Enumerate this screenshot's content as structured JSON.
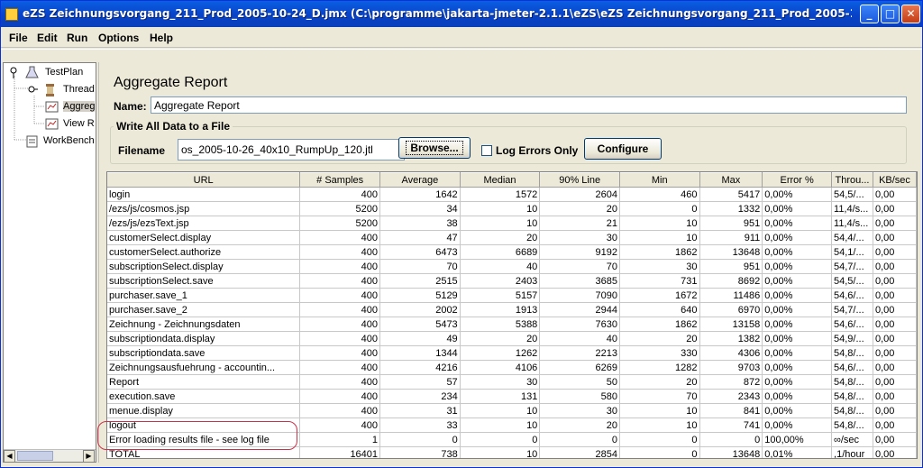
{
  "window": {
    "title": "eZS Zeichnungsvorgang_211_Prod_2005-10-24_D.jmx (C:\\programme\\jakarta-jmeter-2.1.1\\eZS\\eZS Zeichnungsvorgang_211_Prod_2005-10-24_...",
    "minimize": "_",
    "maximize": "□",
    "close": "✕"
  },
  "menu": [
    "File",
    "Edit",
    "Run",
    "Options",
    "Help"
  ],
  "tree": {
    "items": [
      {
        "label": "TestPlan",
        "icon": "flask-icon"
      },
      {
        "label": "Thread",
        "icon": "spool-icon"
      },
      {
        "label": "Aggreg",
        "icon": "report-icon"
      },
      {
        "label": "View R",
        "icon": "report-icon"
      },
      {
        "label": "WorkBench",
        "icon": "clipboard-icon"
      }
    ],
    "scroll_left": "◀",
    "scroll_right": "▶"
  },
  "report": {
    "title": "Aggregate Report",
    "name_label": "Name:",
    "name_value": "Aggregate Report",
    "group_title": "Write All Data to a File",
    "filename_label": "Filename",
    "filename_value": "os_2005-10-26_40x10_RumpUp_120.jtl",
    "browse_label": "Browse...",
    "log_errors_label": "Log Errors Only",
    "configure_label": "Configure"
  },
  "table": {
    "columns": [
      "URL",
      "# Samples",
      "Average",
      "Median",
      "90% Line",
      "Min",
      "Max",
      "Error %",
      "Throu...",
      "KB/sec"
    ],
    "rows": [
      [
        "login",
        "400",
        "1642",
        "1572",
        "2604",
        "460",
        "5417",
        "0,00%",
        "54,5/...",
        "0,00"
      ],
      [
        "/ezs/js/cosmos.jsp",
        "5200",
        "34",
        "10",
        "20",
        "0",
        "1332",
        "0,00%",
        "11,4/s...",
        "0,00"
      ],
      [
        "/ezs/js/ezsText.jsp",
        "5200",
        "38",
        "10",
        "21",
        "10",
        "951",
        "0,00%",
        "11,4/s...",
        "0,00"
      ],
      [
        "customerSelect.display",
        "400",
        "47",
        "20",
        "30",
        "10",
        "911",
        "0,00%",
        "54,4/...",
        "0,00"
      ],
      [
        "customerSelect.authorize",
        "400",
        "6473",
        "6689",
        "9192",
        "1862",
        "13648",
        "0,00%",
        "54,1/...",
        "0,00"
      ],
      [
        "subscriptionSelect.display",
        "400",
        "70",
        "40",
        "70",
        "30",
        "951",
        "0,00%",
        "54,7/...",
        "0,00"
      ],
      [
        "subscriptionSelect.save",
        "400",
        "2515",
        "2403",
        "3685",
        "731",
        "8692",
        "0,00%",
        "54,5/...",
        "0,00"
      ],
      [
        "purchaser.save_1",
        "400",
        "5129",
        "5157",
        "7090",
        "1672",
        "11486",
        "0,00%",
        "54,6/...",
        "0,00"
      ],
      [
        "purchaser.save_2",
        "400",
        "2002",
        "1913",
        "2944",
        "640",
        "6970",
        "0,00%",
        "54,7/...",
        "0,00"
      ],
      [
        "Zeichnung - Zeichnungsdaten",
        "400",
        "5473",
        "5388",
        "7630",
        "1862",
        "13158",
        "0,00%",
        "54,6/...",
        "0,00"
      ],
      [
        "subscriptiondata.display",
        "400",
        "49",
        "20",
        "40",
        "20",
        "1382",
        "0,00%",
        "54,9/...",
        "0,00"
      ],
      [
        "subscriptiondata.save",
        "400",
        "1344",
        "1262",
        "2213",
        "330",
        "4306",
        "0,00%",
        "54,8/...",
        "0,00"
      ],
      [
        "Zeichnungsausfuehrung - accountin...",
        "400",
        "4216",
        "4106",
        "6269",
        "1282",
        "9703",
        "0,00%",
        "54,6/...",
        "0,00"
      ],
      [
        "Report",
        "400",
        "57",
        "30",
        "50",
        "20",
        "872",
        "0,00%",
        "54,8/...",
        "0,00"
      ],
      [
        "execution.save",
        "400",
        "234",
        "131",
        "580",
        "70",
        "2343",
        "0,00%",
        "54,8/...",
        "0,00"
      ],
      [
        "menue.display",
        "400",
        "31",
        "10",
        "30",
        "10",
        "841",
        "0,00%",
        "54,8/...",
        "0,00"
      ],
      [
        "logout",
        "400",
        "33",
        "10",
        "20",
        "10",
        "741",
        "0,00%",
        "54,8/...",
        "0,00"
      ],
      [
        "Error loading results file - see log file",
        "1",
        "0",
        "0",
        "0",
        "0",
        "0",
        "100,00%",
        "∞/sec",
        "0,00"
      ],
      [
        "TOTAL",
        "16401",
        "738",
        "10",
        "2854",
        "0",
        "13648",
        "0,01%",
        ",1/hour",
        "0,00"
      ]
    ]
  }
}
